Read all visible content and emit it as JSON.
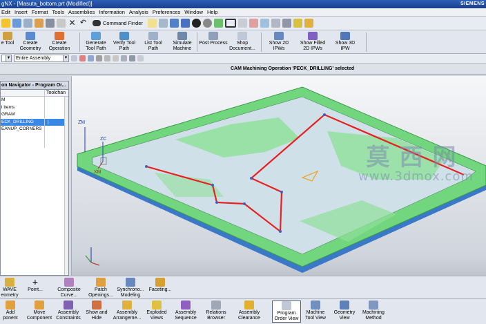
{
  "window": {
    "title": "gNX 8 - [Masuta_bottom.prt (Modified)]",
    "title_visible": "gNX - [Masuta_bottom.prt (Modified)]",
    "brand": "SIEMENS"
  },
  "menu": [
    "Edit",
    "Insert",
    "Format",
    "Tools",
    "Assemblies",
    "Information",
    "Analysis",
    "Preferences",
    "Window",
    "Help"
  ],
  "toolbar": {
    "command_finder_label": "Command Finder"
  },
  "ribbon": {
    "buttons": [
      {
        "name": "create-tool",
        "label": "e Tool"
      },
      {
        "name": "create-geometry",
        "label": "Create\nGeometry"
      },
      {
        "name": "create-operation",
        "label": "Create\nOperation"
      },
      {
        "name": "generate-tool-path",
        "label": "Generate\nTool Path"
      },
      {
        "name": "verify-tool-path",
        "label": "Verify Tool\nPath"
      },
      {
        "name": "list-tool-path",
        "label": "List Tool\nPath"
      },
      {
        "name": "simulate-machine",
        "label": "Simulate\nMachine"
      },
      {
        "name": "post-process",
        "label": "Post Process"
      },
      {
        "name": "shop-document",
        "label": "Shop\nDocument..."
      },
      {
        "name": "show-2d-ipws",
        "label": "Show 2D\nIPWs"
      },
      {
        "name": "show-filled-2d-ipws",
        "label": "Show Filled\n2D IPWs"
      },
      {
        "name": "show-3d-ipw",
        "label": "Show 3D\nIPW"
      }
    ]
  },
  "selection": {
    "filter_value": "",
    "scope_value": "Entire Assembly"
  },
  "status": {
    "message": "CAM Machining Operation 'PECK_DRILLING' selected"
  },
  "navigator": {
    "title": "on Navigator - Program Or...",
    "columns": [
      "",
      "Toolchan"
    ],
    "rows": [
      {
        "name": "M",
        "tool": ""
      },
      {
        "name": "l Items",
        "tool": ""
      },
      {
        "name": "GRAM",
        "tool": ""
      },
      {
        "name": "ECK_DRILLING",
        "tool": "|",
        "selected": true
      },
      {
        "name": "EANUP_CORNERS",
        "tool": ""
      },
      {
        "name": "",
        "tool": ""
      },
      {
        "name": "",
        "tool": ""
      }
    ]
  },
  "axes": {
    "zm": "ZM",
    "zc": "ZC",
    "xm": "XM"
  },
  "watermark": {
    "cn": "莫西网",
    "url": "www.3dmox.com"
  },
  "bottom_row1": [
    {
      "name": "wave-geometry",
      "label": "WAVE\neometry"
    },
    {
      "name": "point",
      "label": "Point..."
    },
    {
      "name": "composite-curve",
      "label": "Composite\nCurve..."
    },
    {
      "name": "patch-openings",
      "label": "Patch\nOpenings..."
    },
    {
      "name": "synchronous-modeling",
      "label": "Synchrono...\nModeling"
    },
    {
      "name": "faceting",
      "label": "Faceting..."
    }
  ],
  "bottom_row2": [
    {
      "name": "add",
      "label": "Add\nponent"
    },
    {
      "name": "move-component",
      "label": "Move\nComponent"
    },
    {
      "name": "assembly-constraints",
      "label": "Assembly\nConstraints"
    },
    {
      "name": "show-and-hide",
      "label": "Show and\nHide"
    },
    {
      "name": "assembly-arrangements",
      "label": "Assembly\nArrangeme..."
    },
    {
      "name": "exploded-views",
      "label": "Exploded\nViews"
    },
    {
      "name": "assembly-sequence",
      "label": "Assembly\nSequence"
    },
    {
      "name": "relations-browser",
      "label": "Relations\nBrowser"
    },
    {
      "name": "assembly-clearance",
      "label": "Assembly\nClearance"
    },
    {
      "name": "program-order-view",
      "label": "Program\nOrder View",
      "active": true
    },
    {
      "name": "machine-tool-view",
      "label": "Machine\nTool View"
    },
    {
      "name": "geometry-view",
      "label": "Geometry\nView"
    },
    {
      "name": "machining-method",
      "label": "Machining\nMethod"
    }
  ],
  "colors": {
    "part_surface": "#cfe0e8",
    "stock_green": "#7fe08a",
    "toolpath": "#e82020",
    "selection_blue": "#3a88e6"
  }
}
